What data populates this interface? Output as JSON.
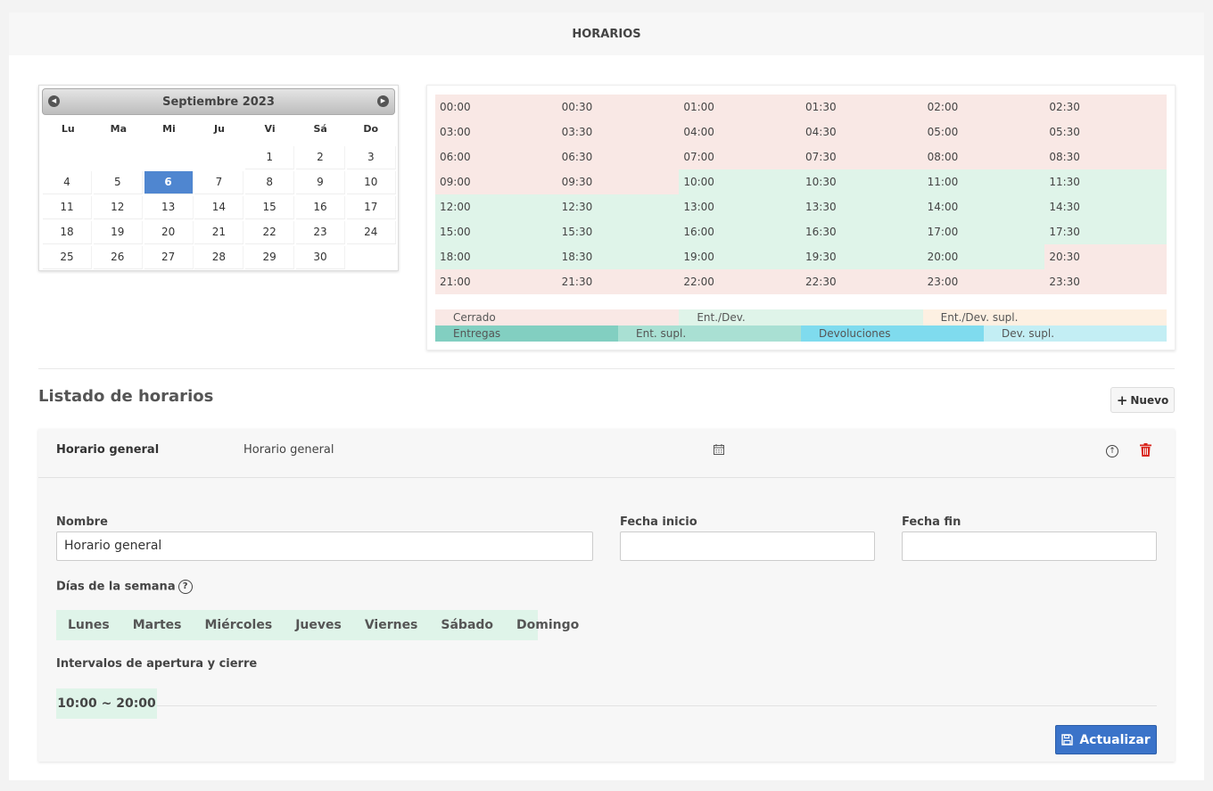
{
  "header": {
    "title": "HORARIOS"
  },
  "calendar": {
    "month_title": "Septiembre 2023",
    "weekdays": [
      "Lu",
      "Ma",
      "Mi",
      "Ju",
      "Vi",
      "Sá",
      "Do"
    ],
    "leading_blanks": 4,
    "days": [
      "1",
      "2",
      "3",
      "4",
      "5",
      "6",
      "7",
      "8",
      "9",
      "10",
      "11",
      "12",
      "13",
      "14",
      "15",
      "16",
      "17",
      "18",
      "19",
      "20",
      "21",
      "22",
      "23",
      "24",
      "25",
      "26",
      "27",
      "28",
      "29",
      "30"
    ],
    "selected_day": "6",
    "colors": {
      "selected": "#4f86d0"
    }
  },
  "schedule": {
    "slots": [
      {
        "time": "00:00",
        "state": "closed"
      },
      {
        "time": "00:30",
        "state": "closed"
      },
      {
        "time": "01:00",
        "state": "closed"
      },
      {
        "time": "01:30",
        "state": "closed"
      },
      {
        "time": "02:00",
        "state": "closed"
      },
      {
        "time": "02:30",
        "state": "closed"
      },
      {
        "time": "03:00",
        "state": "closed"
      },
      {
        "time": "03:30",
        "state": "closed"
      },
      {
        "time": "04:00",
        "state": "closed"
      },
      {
        "time": "04:30",
        "state": "closed"
      },
      {
        "time": "05:00",
        "state": "closed"
      },
      {
        "time": "05:30",
        "state": "closed"
      },
      {
        "time": "06:00",
        "state": "closed"
      },
      {
        "time": "06:30",
        "state": "closed"
      },
      {
        "time": "07:00",
        "state": "closed"
      },
      {
        "time": "07:30",
        "state": "closed"
      },
      {
        "time": "08:00",
        "state": "closed"
      },
      {
        "time": "08:30",
        "state": "closed"
      },
      {
        "time": "09:00",
        "state": "closed"
      },
      {
        "time": "09:30",
        "state": "closed"
      },
      {
        "time": "10:00",
        "state": "open"
      },
      {
        "time": "10:30",
        "state": "open"
      },
      {
        "time": "11:00",
        "state": "open"
      },
      {
        "time": "11:30",
        "state": "open"
      },
      {
        "time": "12:00",
        "state": "open"
      },
      {
        "time": "12:30",
        "state": "open"
      },
      {
        "time": "13:00",
        "state": "open"
      },
      {
        "time": "13:30",
        "state": "open"
      },
      {
        "time": "14:00",
        "state": "open"
      },
      {
        "time": "14:30",
        "state": "open"
      },
      {
        "time": "15:00",
        "state": "open"
      },
      {
        "time": "15:30",
        "state": "open"
      },
      {
        "time": "16:00",
        "state": "open"
      },
      {
        "time": "16:30",
        "state": "open"
      },
      {
        "time": "17:00",
        "state": "open"
      },
      {
        "time": "17:30",
        "state": "open"
      },
      {
        "time": "18:00",
        "state": "open"
      },
      {
        "time": "18:30",
        "state": "open"
      },
      {
        "time": "19:00",
        "state": "open"
      },
      {
        "time": "19:30",
        "state": "open"
      },
      {
        "time": "20:00",
        "state": "open"
      },
      {
        "time": "20:30",
        "state": "closed"
      },
      {
        "time": "21:00",
        "state": "closed"
      },
      {
        "time": "21:30",
        "state": "closed"
      },
      {
        "time": "22:00",
        "state": "closed"
      },
      {
        "time": "22:30",
        "state": "closed"
      },
      {
        "time": "23:00",
        "state": "closed"
      },
      {
        "time": "23:30",
        "state": "closed"
      }
    ],
    "legend_row1": [
      {
        "label": "Cerrado",
        "color": "#f9e8e5"
      },
      {
        "label": "Ent./Dev.",
        "color": "#dff4e9"
      },
      {
        "label": "Ent./Dev. supl.",
        "color": "#fdf0e2"
      }
    ],
    "legend_row2": [
      {
        "label": "Entregas",
        "color": "#82cfc1"
      },
      {
        "label": "Ent. supl.",
        "color": "#a9e0d3"
      },
      {
        "label": "Devoluciones",
        "color": "#7fdbee"
      },
      {
        "label": "Dev. supl.",
        "color": "#c3eef4"
      }
    ]
  },
  "list": {
    "title": "Listado de horarios",
    "new_button": "Nuevo",
    "item": {
      "name": "Horario general",
      "description": "Horario general",
      "form": {
        "name_label": "Nombre",
        "name_value": "Horario general",
        "start_label": "Fecha inicio",
        "start_value": "",
        "end_label": "Fecha fin",
        "end_value": "",
        "weekdays_label": "Días de la semana",
        "weekdays": [
          "Lunes",
          "Martes",
          "Miércoles",
          "Jueves",
          "Viernes",
          "Sábado",
          "Domingo"
        ],
        "intervals_label": "Intervalos de apertura y cierre",
        "intervals": [
          "10:00 ~ 20:00"
        ],
        "update_button": "Actualizar"
      }
    }
  }
}
